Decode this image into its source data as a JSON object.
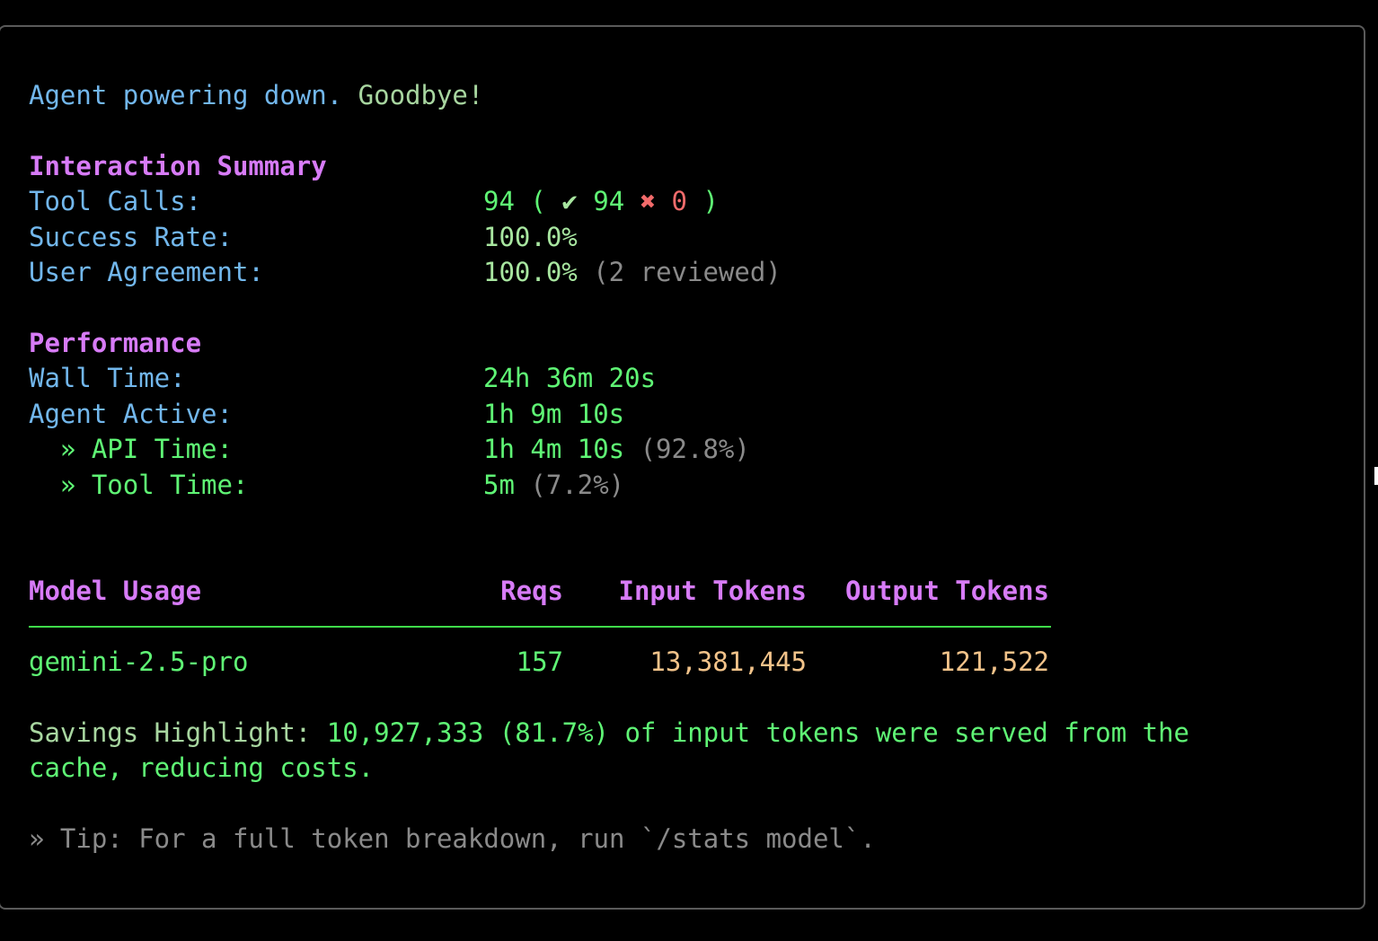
{
  "goodbye": {
    "part1": "Agent powering down.",
    "part2": " Goodbye!"
  },
  "interaction": {
    "heading": "Interaction Summary",
    "tool_calls_label": "Tool Calls:",
    "tool_calls_total": "94",
    "tool_calls_open": " ( ",
    "check_icon": "✔",
    "tool_calls_success": " 94 ",
    "cross_icon": "✖",
    "tool_calls_fail": " 0",
    "tool_calls_close": " )",
    "success_rate_label": "Success Rate:",
    "success_rate_value": "100.0%",
    "user_agreement_label": "User Agreement:",
    "user_agreement_value": "100.0%",
    "user_agreement_note": " (2 reviewed)"
  },
  "performance": {
    "heading": "Performance",
    "wall_time_label": "Wall Time:",
    "wall_time_value": "24h 36m 20s",
    "agent_active_label": "Agent Active:",
    "agent_active_value": "1h 9m 10s",
    "api_time_label": "  » API Time:",
    "api_time_value": "1h 4m 10s",
    "api_time_pct": " (92.8%)",
    "tool_time_label": "  » Tool Time:",
    "tool_time_value": "5m",
    "tool_time_pct": " (7.2%)"
  },
  "model_usage": {
    "heading": "Model Usage",
    "col_reqs": "Reqs",
    "col_input": "Input Tokens",
    "col_output": "Output Tokens",
    "rows": [
      {
        "model": "gemini-2.5-pro",
        "reqs": "157",
        "input": "13,381,445",
        "output": "121,522"
      }
    ]
  },
  "savings": {
    "label": "Savings Highlight: ",
    "text_line1": "10,927,333 (81.7%) of input tokens were served from the",
    "text_line2": "cache, reducing costs."
  },
  "tip": {
    "text": "» Tip: For a full token breakdown, run `/stats model`."
  },
  "colors": {
    "heading": "#d77bf7",
    "label": "#72b7ec",
    "value": "#5ff575",
    "muted": "#8a8a8a",
    "error": "#f26b6b",
    "tokens": "#f2c38a"
  }
}
